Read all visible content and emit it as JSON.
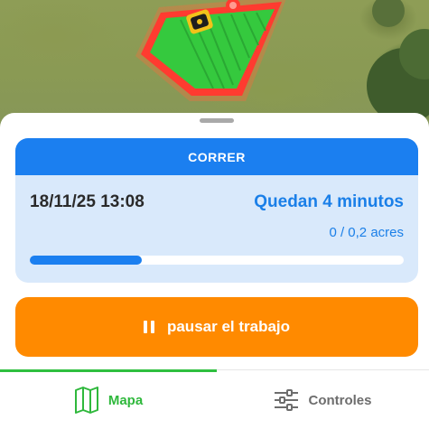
{
  "map": {
    "field_color": "#2ec43a",
    "boundary_color": "#ff3b30",
    "mower_icon": "robot-mower-icon"
  },
  "job": {
    "header": "CORRER",
    "date": "18/11/25 13:08",
    "remaining": "Quedan 4 minutos",
    "area": "0 / 0,2 acres",
    "progress": 0.3
  },
  "actions": {
    "pause_label": "pausar el trabajo",
    "pause_icon": "pause-icon"
  },
  "tabs": [
    {
      "label": "Mapa",
      "icon": "map-icon",
      "active": true
    },
    {
      "label": "Controles",
      "icon": "sliders-icon",
      "active": false
    }
  ],
  "colors": {
    "accent_blue": "#1b7ff0",
    "accent_orange": "#ff8a00",
    "accent_green": "#2fbf3f"
  }
}
